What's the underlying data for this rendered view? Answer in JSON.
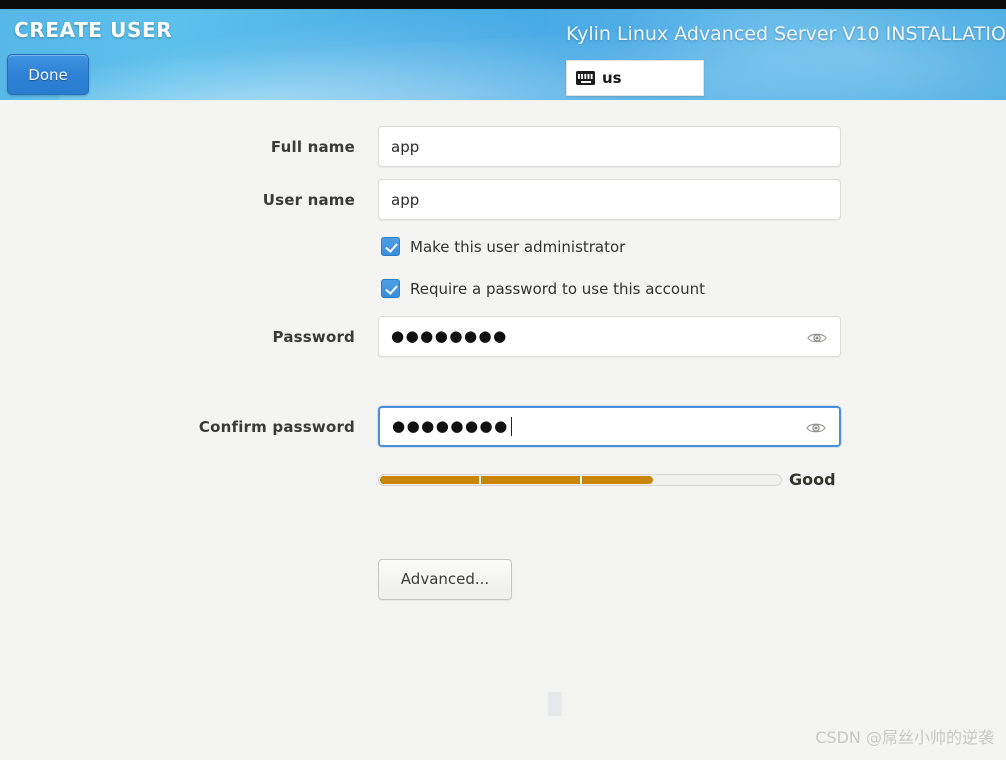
{
  "header": {
    "spoke_title": "CREATE USER",
    "done_label": "Done",
    "product_title": "Kylin Linux Advanced Server V10 INSTALLATIO",
    "keyboard_layout": "us",
    "keyboard_icon": "keyboard-icon",
    "accent_blue": "#4aaee6",
    "done_button_color": "#2d81d6"
  },
  "form": {
    "fields": [
      {
        "label": "Full name",
        "value": "app"
      },
      {
        "label": "User name",
        "value": "app"
      }
    ],
    "checkboxes": [
      {
        "label": "Make this user administrator",
        "checked": true
      },
      {
        "label": "Require a password to use this account",
        "checked": true
      }
    ],
    "password": {
      "label": "Password",
      "masked_value": "●●●●●●●●",
      "character_count": 8,
      "reveal_icon": "eye-icon"
    },
    "confirm_password": {
      "label": "Confirm password",
      "masked_value": "●●●●●●●●",
      "character_count": 8,
      "reveal_icon": "eye-icon",
      "focused": true
    },
    "strength": {
      "text": "Good",
      "percent": 68,
      "segments": 4,
      "fill_color": "#c8860d",
      "track_color": "#f1f1ef"
    },
    "advanced_label": "Advanced..."
  },
  "watermark": {
    "text": "CSDN @屌丝小帅的逆袭"
  }
}
